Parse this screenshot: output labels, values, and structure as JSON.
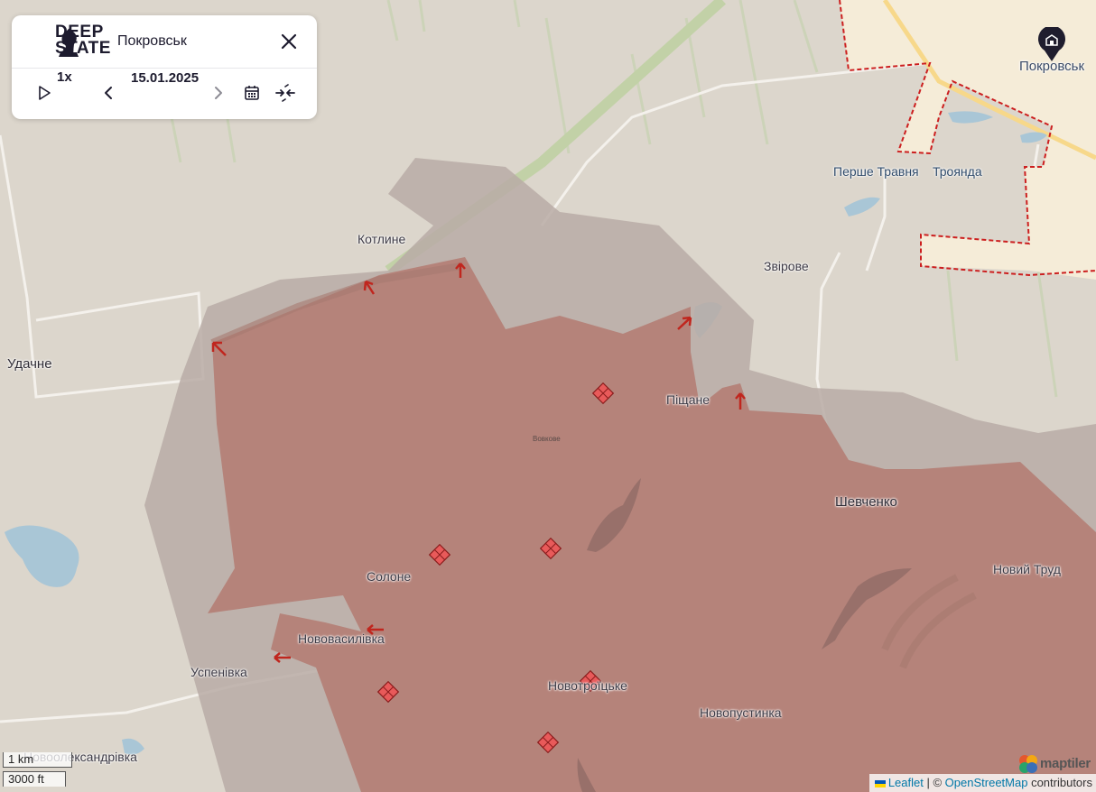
{
  "app": {
    "brand_line1": "DEEP",
    "brand_line2": "STATE",
    "panel_title": "Покровськ"
  },
  "controls": {
    "speed": "1x",
    "date": "15.01.2025",
    "icons": [
      "play-icon",
      "prev-icon",
      "next-icon",
      "calendar-icon",
      "compress-icon",
      "close-icon"
    ]
  },
  "places": {
    "pokrovsk": "Покровськ",
    "pershe_travnia": "Перше Травня",
    "troianda": "Троянда",
    "kotlyne": "Котлине",
    "zvirove": "Звірове",
    "udachne": "Удачне",
    "pishchane": "Піщане",
    "vovkove": "Вовкове",
    "shevchenko": "Шевченко",
    "novyi_trud": "Новий Труд",
    "solone": "Солоне",
    "novovasylivka": "Нововасилівка",
    "uspenivka": "Успенівка",
    "novotroitske": "Новотроїцьке",
    "novopustynka": "Новопустинка",
    "novooleksandrivka": "Новоолександрівка"
  },
  "scale": {
    "metric": "1 km",
    "imperial": "3000 ft"
  },
  "attribution": {
    "leaflet": "Leaflet",
    "separator": " | © ",
    "osm": "OpenStreetMap",
    "contributors": " contributors",
    "maptiler": "maptiler"
  },
  "colors": {
    "occupied": "#b5837a",
    "contested": "#b8aca6",
    "land": "#dcd6cc",
    "city": "#f5ecd8",
    "water": "#a9c6d6",
    "frontline": "#cc1f1f"
  }
}
